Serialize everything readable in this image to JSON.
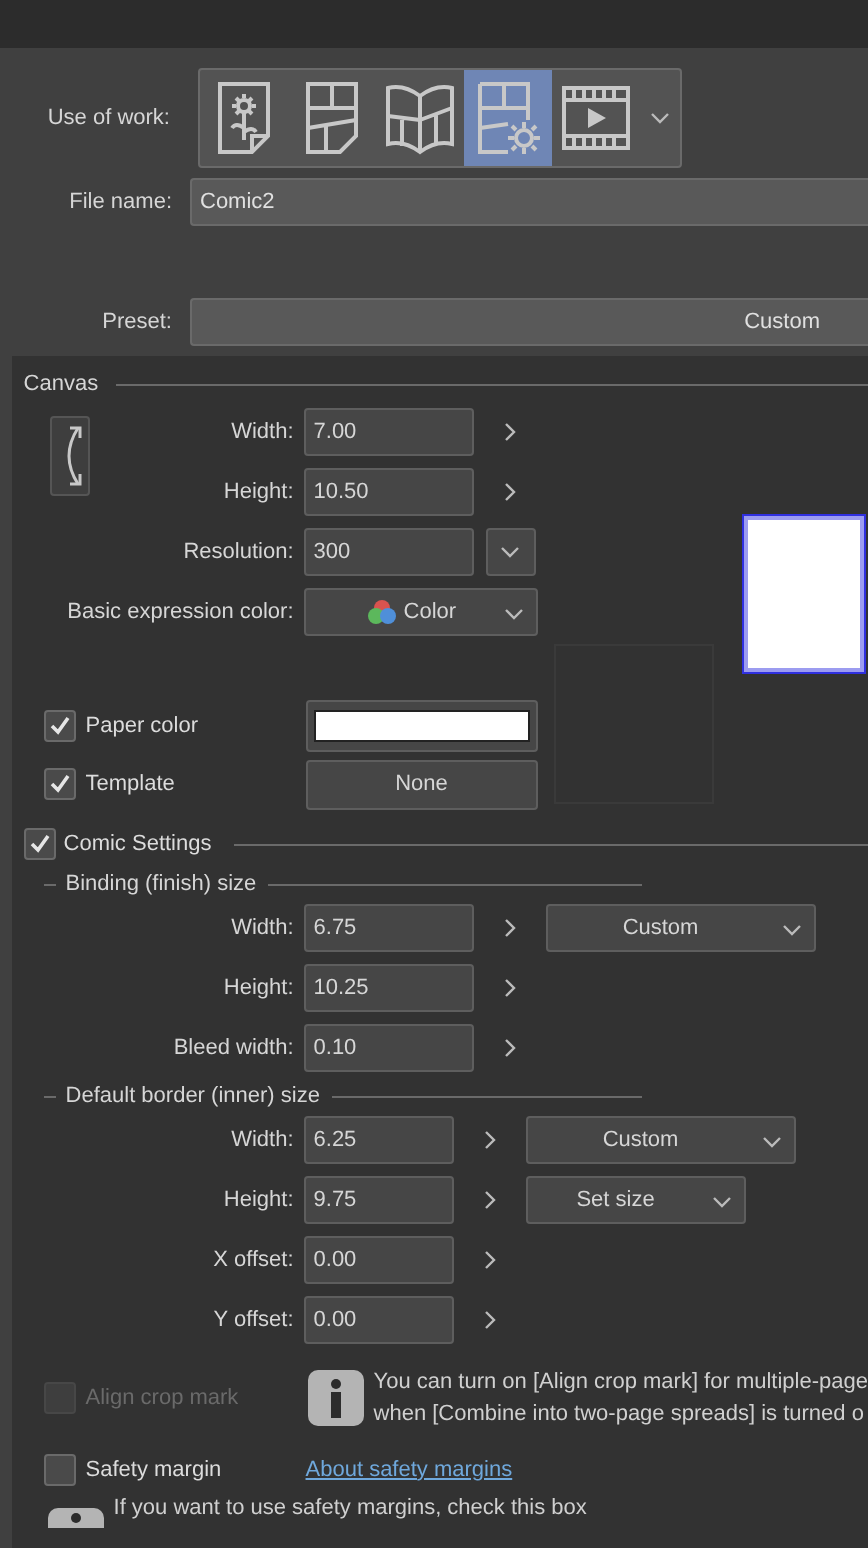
{
  "use_of_work": {
    "label": "Use of work:",
    "options": [
      {
        "kind": "illustration",
        "selected": false
      },
      {
        "kind": "comic",
        "selected": false
      },
      {
        "kind": "book",
        "selected": false
      },
      {
        "kind": "comic_settings",
        "selected": true
      },
      {
        "kind": "animation",
        "selected": false
      }
    ]
  },
  "file_name": {
    "label": "File name:",
    "value": "Comic2"
  },
  "preset": {
    "label": "Preset:",
    "value": "Custom"
  },
  "canvas": {
    "title": "Canvas",
    "fields": [
      {
        "label": "Width:",
        "value": "7.00",
        "kind": "stepper"
      },
      {
        "label": "Height:",
        "value": "10.50",
        "kind": "stepper"
      },
      {
        "label": "Resolution:",
        "value": "300",
        "kind": "dropdown"
      }
    ],
    "expression_color": {
      "label": "Basic expression color:",
      "value": "Color"
    },
    "paper_color": {
      "label": "Paper color",
      "checked": true,
      "color": "#ffffff"
    },
    "template": {
      "label": "Template",
      "checked": true,
      "value": "None"
    }
  },
  "comic_settings": {
    "label": "Comic Settings",
    "checked": true,
    "binding": {
      "title": "Binding (finish) size",
      "fields": [
        {
          "label": "Width:",
          "value": "6.75",
          "preset": "Custom"
        },
        {
          "label": "Height:",
          "value": "10.25"
        },
        {
          "label": "Bleed width:",
          "value": "0.10"
        }
      ]
    },
    "border": {
      "title": "Default border (inner) size",
      "fields": [
        {
          "label": "Width:",
          "value": "6.25",
          "preset": "Custom"
        },
        {
          "label": "Height:",
          "value": "9.75",
          "preset": "Set size"
        },
        {
          "label": "X offset:",
          "value": "0.00"
        },
        {
          "label": "Y offset:",
          "value": "0.00"
        }
      ]
    },
    "align_crop_mark": {
      "label": "Align crop mark",
      "checked": false,
      "disabled": true
    },
    "info": [
      "You can turn on [Align crop mark] for multiple-page",
      "when [Combine into two-page spreads] is turned o"
    ],
    "safety_margin": {
      "label": "Safety margin",
      "checked": false,
      "link": "About safety margins"
    },
    "safety_hint": "If you want to use safety margins, check this box"
  }
}
